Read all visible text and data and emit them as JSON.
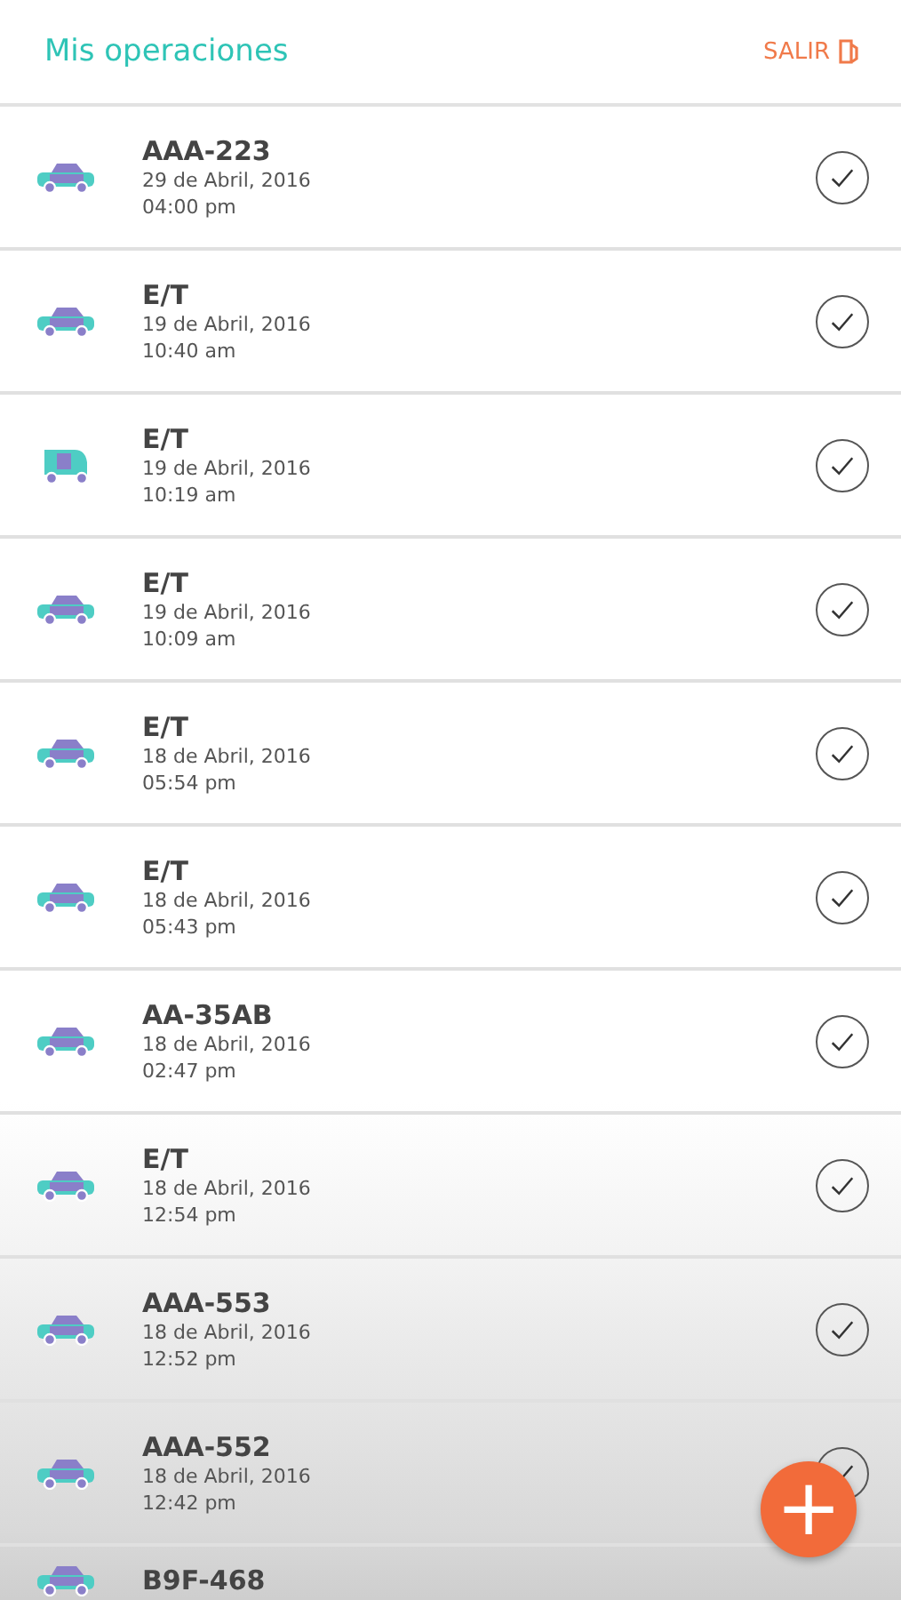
{
  "header": {
    "title": "Mis operaciones",
    "logout": "SALIR"
  },
  "operations": [
    {
      "kind": "car",
      "plate": "AAA-223",
      "date": "29 de Abril, 2016",
      "time": "04:00 pm",
      "completed": true
    },
    {
      "kind": "car",
      "plate": "E/T",
      "date": "19 de Abril, 2016",
      "time": "10:40 am",
      "completed": true
    },
    {
      "kind": "mototaxi",
      "plate": "E/T",
      "date": "19 de Abril, 2016",
      "time": "10:19 am",
      "completed": true
    },
    {
      "kind": "car",
      "plate": "E/T",
      "date": "19 de Abril, 2016",
      "time": "10:09 am",
      "completed": true
    },
    {
      "kind": "car",
      "plate": "E/T",
      "date": "18 de Abril, 2016",
      "time": "05:54 pm",
      "completed": true
    },
    {
      "kind": "car",
      "plate": "E/T",
      "date": "18 de Abril, 2016",
      "time": "05:43 pm",
      "completed": true
    },
    {
      "kind": "car",
      "plate": "AA-35AB",
      "date": "18 de Abril, 2016",
      "time": "02:47 pm",
      "completed": true
    },
    {
      "kind": "car",
      "plate": "E/T",
      "date": "18 de Abril, 2016",
      "time": "12:54 pm",
      "completed": true
    },
    {
      "kind": "car",
      "plate": "AAA-553",
      "date": "18 de Abril, 2016",
      "time": "12:52 pm",
      "completed": true
    },
    {
      "kind": "car",
      "plate": "AAA-552",
      "date": "18 de Abril, 2016",
      "time": "12:42 pm",
      "completed": true
    },
    {
      "kind": "car",
      "plate": "B9F-468"
    }
  ],
  "add_button": {
    "label": "+"
  }
}
